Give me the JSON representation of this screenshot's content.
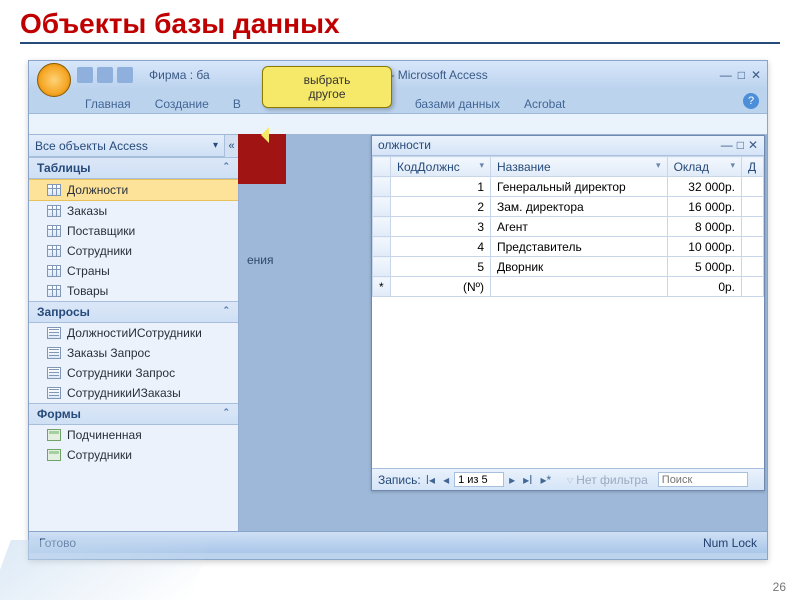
{
  "slide": {
    "title": "Объекты базы данных",
    "page_number": "26"
  },
  "callout": {
    "line1": "выбрать",
    "line2": "другое"
  },
  "window": {
    "title_prefix": "Фирма : ба",
    "title_suffix": "00) - Microsoft Access",
    "tabs": {
      "home": "Главная",
      "create": "Создание",
      "unknown": "В",
      "dbtools": "базами данных",
      "acrobat": "Acrobat"
    }
  },
  "nav": {
    "header": "Все объекты Access",
    "sections": {
      "tables": "Таблицы",
      "queries": "Запросы",
      "forms": "Формы"
    },
    "tables": [
      "Должности",
      "Заказы",
      "Поставщики",
      "Сотрудники",
      "Страны",
      "Товары"
    ],
    "queries": [
      "ДолжностиИСотрудники",
      "Заказы Запрос",
      "Сотрудники Запрос",
      "СотрудникиИЗаказы"
    ],
    "forms": [
      "Подчиненная",
      "Сотрудники"
    ]
  },
  "docarea": {
    "snippet_label": "ения",
    "table_caption": "олжности"
  },
  "table": {
    "columns": {
      "id": "КодДолжнс",
      "name": "Название",
      "salary": "Оклад",
      "extra": "Д"
    },
    "rows": [
      {
        "id": "1",
        "name": "Генеральный директор",
        "salary": "32 000р."
      },
      {
        "id": "2",
        "name": "Зам. директора",
        "salary": "16 000р."
      },
      {
        "id": "3",
        "name": "Агент",
        "salary": "8 000р."
      },
      {
        "id": "4",
        "name": "Представитель",
        "salary": "10 000р."
      },
      {
        "id": "5",
        "name": "Дворник",
        "salary": "5 000р."
      }
    ],
    "newrow": {
      "id": "(Nº)",
      "salary": "0р."
    }
  },
  "recnav": {
    "label": "Запись:",
    "pos": "1 из 5",
    "filter": "Нет фильтра",
    "search": "Поиск"
  },
  "statusbar": {
    "left": "Готово",
    "right": "Num Lock"
  }
}
